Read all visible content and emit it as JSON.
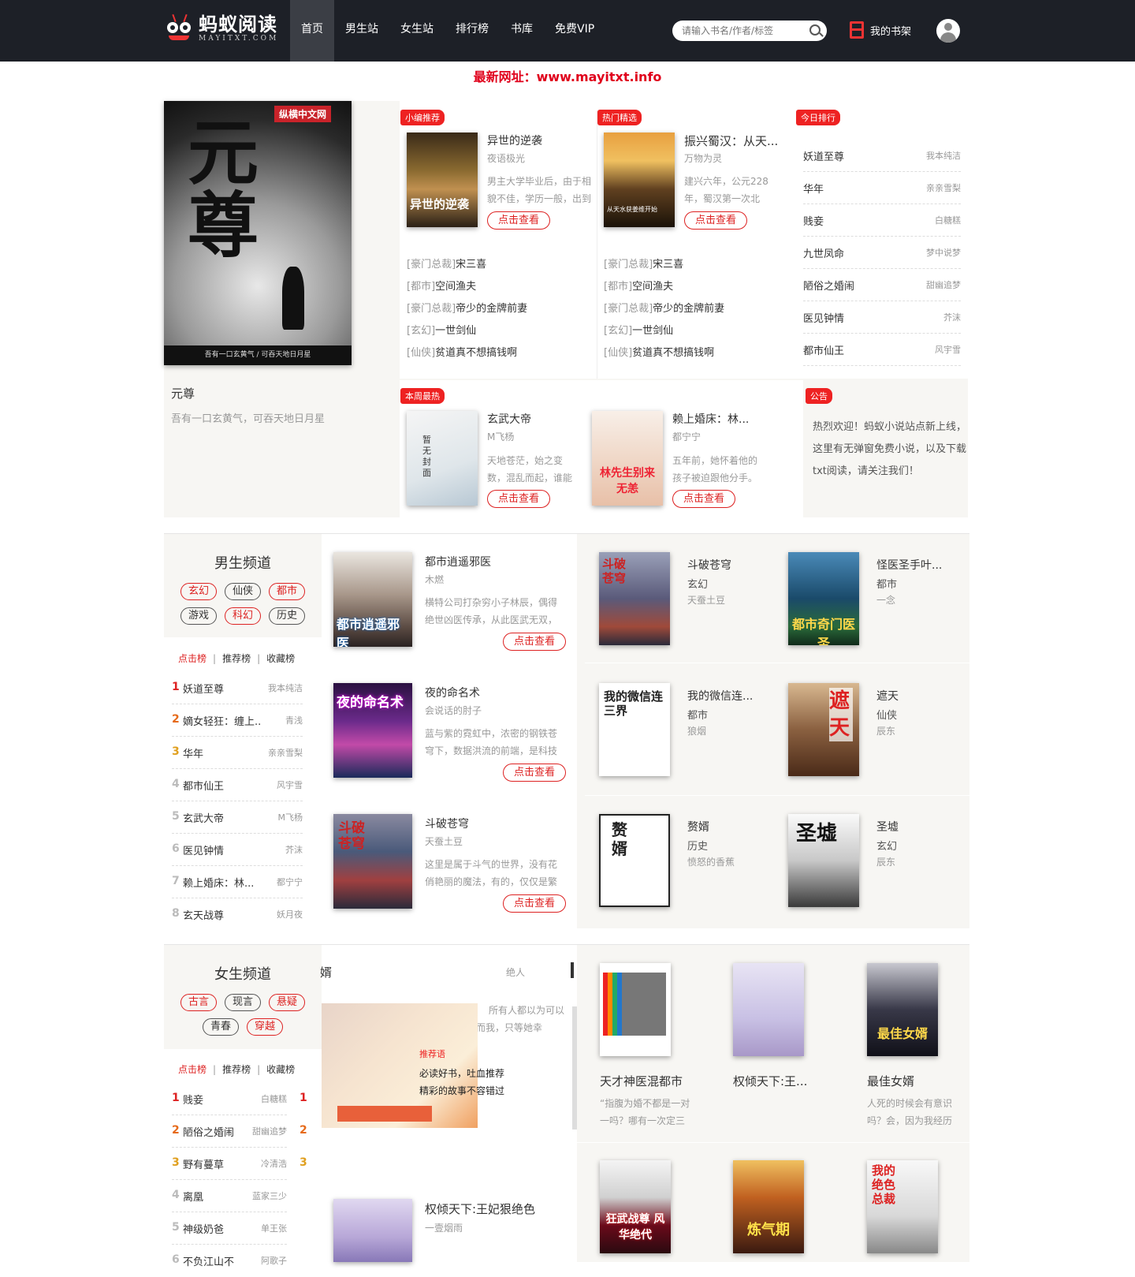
{
  "site": {
    "logo_cn": "蚂蚁阅读",
    "logo_en": "MAYITXT.COM"
  },
  "nav": [
    "首页",
    "男生站",
    "女生站",
    "排行榜",
    "书库",
    "免费VIP"
  ],
  "search": {
    "placeholder": "请输入书名/作者/标签"
  },
  "shelf": "我的书架",
  "notice": "最新网址：www.mayitxt.info",
  "featured": {
    "cover_title": "元尊",
    "cover_badge": "纵横中文网",
    "cover_sub": "吾有一口玄黄气 / 可吞天地日月星",
    "title": "元尊",
    "desc": "吾有一口玄黄气，可吞天地日月星"
  },
  "editor_pick": {
    "tag": "小编推荐",
    "title": "异世的逆袭",
    "author": "夜语极光",
    "desc": "男主大学毕业后，由于相貌不佳，学历一般，出到",
    "btn": "点击查看",
    "cover_text": "异世的逆袭"
  },
  "hot_pick": {
    "tag": "热门精选",
    "title": "振兴蜀汉：从天...",
    "author": "万物为灵",
    "desc": "建兴六年，公元228年，蜀汉第一次北伐……这",
    "btn": "点击查看",
    "cover_text": "从天水获姜维开始"
  },
  "list_left": [
    {
      "cat": "[豪门总裁]",
      "name": "宋三喜"
    },
    {
      "cat": "[都市]",
      "name": "空间渔夫"
    },
    {
      "cat": "[豪门总裁]",
      "name": "帝少的金牌前妻"
    },
    {
      "cat": "[玄幻]",
      "name": "一世剑仙"
    },
    {
      "cat": "[仙侠]",
      "name": "贫道真不想搞钱啊"
    }
  ],
  "list_right": [
    {
      "cat": "[豪门总裁]",
      "name": "宋三喜"
    },
    {
      "cat": "[都市]",
      "name": "空间渔夫"
    },
    {
      "cat": "[豪门总裁]",
      "name": "帝少的金牌前妻"
    },
    {
      "cat": "[玄幻]",
      "name": "一世剑仙"
    },
    {
      "cat": "[仙侠]",
      "name": "贫道真不想搞钱啊"
    }
  ],
  "today_rank": {
    "tag": "今日排行",
    "rows": [
      {
        "name": "妖道至尊",
        "author": "我本纯洁"
      },
      {
        "name": "华年",
        "author": "亲亲雪梨"
      },
      {
        "name": "贱妾",
        "author": "白糖糕"
      },
      {
        "name": "九世凤命",
        "author": "梦中说梦"
      },
      {
        "name": "陋俗之婚闹",
        "author": "甜幽追梦"
      },
      {
        "name": "医见钟情",
        "author": "芥沫"
      },
      {
        "name": "都市仙王",
        "author": "风宇雪"
      }
    ]
  },
  "week_hot": {
    "tag": "本周最热",
    "items": [
      {
        "title": "玄武大帝",
        "author": "M飞杨",
        "desc": "天地苍茫，始之变数，混乱而起，谁能",
        "btn": "点击查看",
        "cover_text": "暂无封面"
      },
      {
        "title": "赖上婚床：林...",
        "author": "都宁宁",
        "desc": "五年前，她怀着他的孩子被迫跟他分手。",
        "btn": "点击查看",
        "cover_text": "林先生别来无恙"
      }
    ]
  },
  "announce": {
    "tag": "公告",
    "text": "热烈欢迎！蚂蚁小说站点新上线，这里有无弹窗免费小说，以及下载txt阅读，请关注我们！"
  },
  "male": {
    "title": "男生频道",
    "pills": [
      {
        "t": "玄幻",
        "red": true
      },
      {
        "t": "仙侠",
        "red": false
      },
      {
        "t": "都市",
        "red": true
      },
      {
        "t": "游戏",
        "red": false
      },
      {
        "t": "科幻",
        "red": true
      },
      {
        "t": "历史",
        "red": false
      }
    ],
    "tabs": [
      "点击榜",
      "推荐榜",
      "收藏榜"
    ],
    "rank": [
      {
        "n": "1",
        "name": "妖道至尊",
        "author": "我本纯洁"
      },
      {
        "n": "2",
        "name": "嫡女轻狂：缠上...",
        "author": "青浅"
      },
      {
        "n": "3",
        "name": "华年",
        "author": "亲亲雪梨"
      },
      {
        "n": "4",
        "name": "都市仙王",
        "author": "风宇雪"
      },
      {
        "n": "5",
        "name": "玄武大帝",
        "author": "M飞杨"
      },
      {
        "n": "6",
        "name": "医见钟情",
        "author": "芥沫"
      },
      {
        "n": "7",
        "name": "赖上婚床：林...",
        "author": "都宁宁"
      },
      {
        "n": "8",
        "name": "玄天战尊",
        "author": "妖月夜"
      }
    ],
    "feature": [
      {
        "title": "都市逍遥邪医",
        "author": "木燃",
        "desc": "横特公司打杂穷小子林辰，偶得绝世凶医传承，从此医武无双，",
        "btn": "点击查看",
        "cover_text": "都市逍遥邪医"
      },
      {
        "title": "夜的命名术",
        "author": "会说话的肘子",
        "desc": "蓝与紫的霓虹中，浓密的钢铁苍穹下，数据洪流的前端，是科技",
        "btn": "点击查看",
        "cover_text": "夜的命名术"
      },
      {
        "title": "斗破苍穹",
        "author": "天蚕土豆",
        "desc": "这里是属于斗气的世界，没有花俏艳丽的魔法，有的，仅仅是繁",
        "btn": "点击查看",
        "cover_text": "斗破苍穹"
      }
    ],
    "grid": [
      {
        "title": "斗破苍穹",
        "cat": "玄幻",
        "author": "天蚕土豆",
        "cover_text": "斗破苍穹"
      },
      {
        "title": "怪医圣手叶...",
        "cat": "都市",
        "author": "一念",
        "cover_text": "都市奇门医圣"
      },
      {
        "title": "我的微信连...",
        "cat": "都市",
        "author": "狼烟",
        "cover_text": "我的微信连三界"
      },
      {
        "title": "遮天",
        "cat": "仙侠",
        "author": "辰东",
        "cover_text": "遮天"
      },
      {
        "title": "赘婿",
        "cat": "历史",
        "author": "愤怒的香蕉",
        "cover_text": "赘婿"
      },
      {
        "title": "圣墟",
        "cat": "玄幻",
        "author": "辰东",
        "cover_text": "圣墟"
      }
    ]
  },
  "female": {
    "title": "女生频道",
    "pills": [
      {
        "t": "古言",
        "red": true
      },
      {
        "t": "现言",
        "red": false
      },
      {
        "t": "悬疑",
        "red": true
      },
      {
        "t": "青春",
        "red": false
      },
      {
        "t": "穿越",
        "red": true
      }
    ],
    "tabs": [
      "点击榜",
      "推荐榜",
      "收藏榜"
    ],
    "rank": [
      {
        "n": "1",
        "name": "贱妾",
        "author": "白糖糕"
      },
      {
        "n": "2",
        "name": "陋俗之婚闹",
        "author": "甜幽追梦"
      },
      {
        "n": "3",
        "name": "野有蔓草",
        "author": "冷清浩"
      },
      {
        "n": "4",
        "name": "离凰",
        "author": "蓝家三少"
      },
      {
        "n": "5",
        "name": "神级奶爸",
        "author": "单王张"
      },
      {
        "n": "6",
        "name": "不负江山不",
        "author": "阿歌子"
      }
    ],
    "slide": {
      "partial_title": "婿",
      "partial_author": "绝人",
      "text1": "所有人都以为可以",
      "text2": "骑在我头上，而我，只等她幸",
      "rec_label": "推荐语",
      "rec1": "必读好书，吐血推荐",
      "rec2": "精彩的故事不容错过",
      "bottom_title": "权倾天下:王妃狠绝色",
      "bottom_author": "一壹烟雨"
    },
    "grid": [
      {
        "title": "天才神医混都市",
        "desc": "“指腹为婚不都是一对一吗？哪有一次定三",
        "cover_text": ""
      },
      {
        "title": "权倾天下:王...",
        "desc": "",
        "cover_text": ""
      },
      {
        "title": "最佳女婿",
        "desc": "人死的时候会有意识吗？会，因为我经历",
        "cover_text": "最佳女婿"
      },
      {
        "title": "",
        "desc": "",
        "cover_text": "狂武战尊 风华绝代"
      },
      {
        "title": "",
        "desc": "",
        "cover_text": "炼气期"
      },
      {
        "title": "",
        "desc": "",
        "cover_text": "我的绝色总裁"
      }
    ]
  }
}
